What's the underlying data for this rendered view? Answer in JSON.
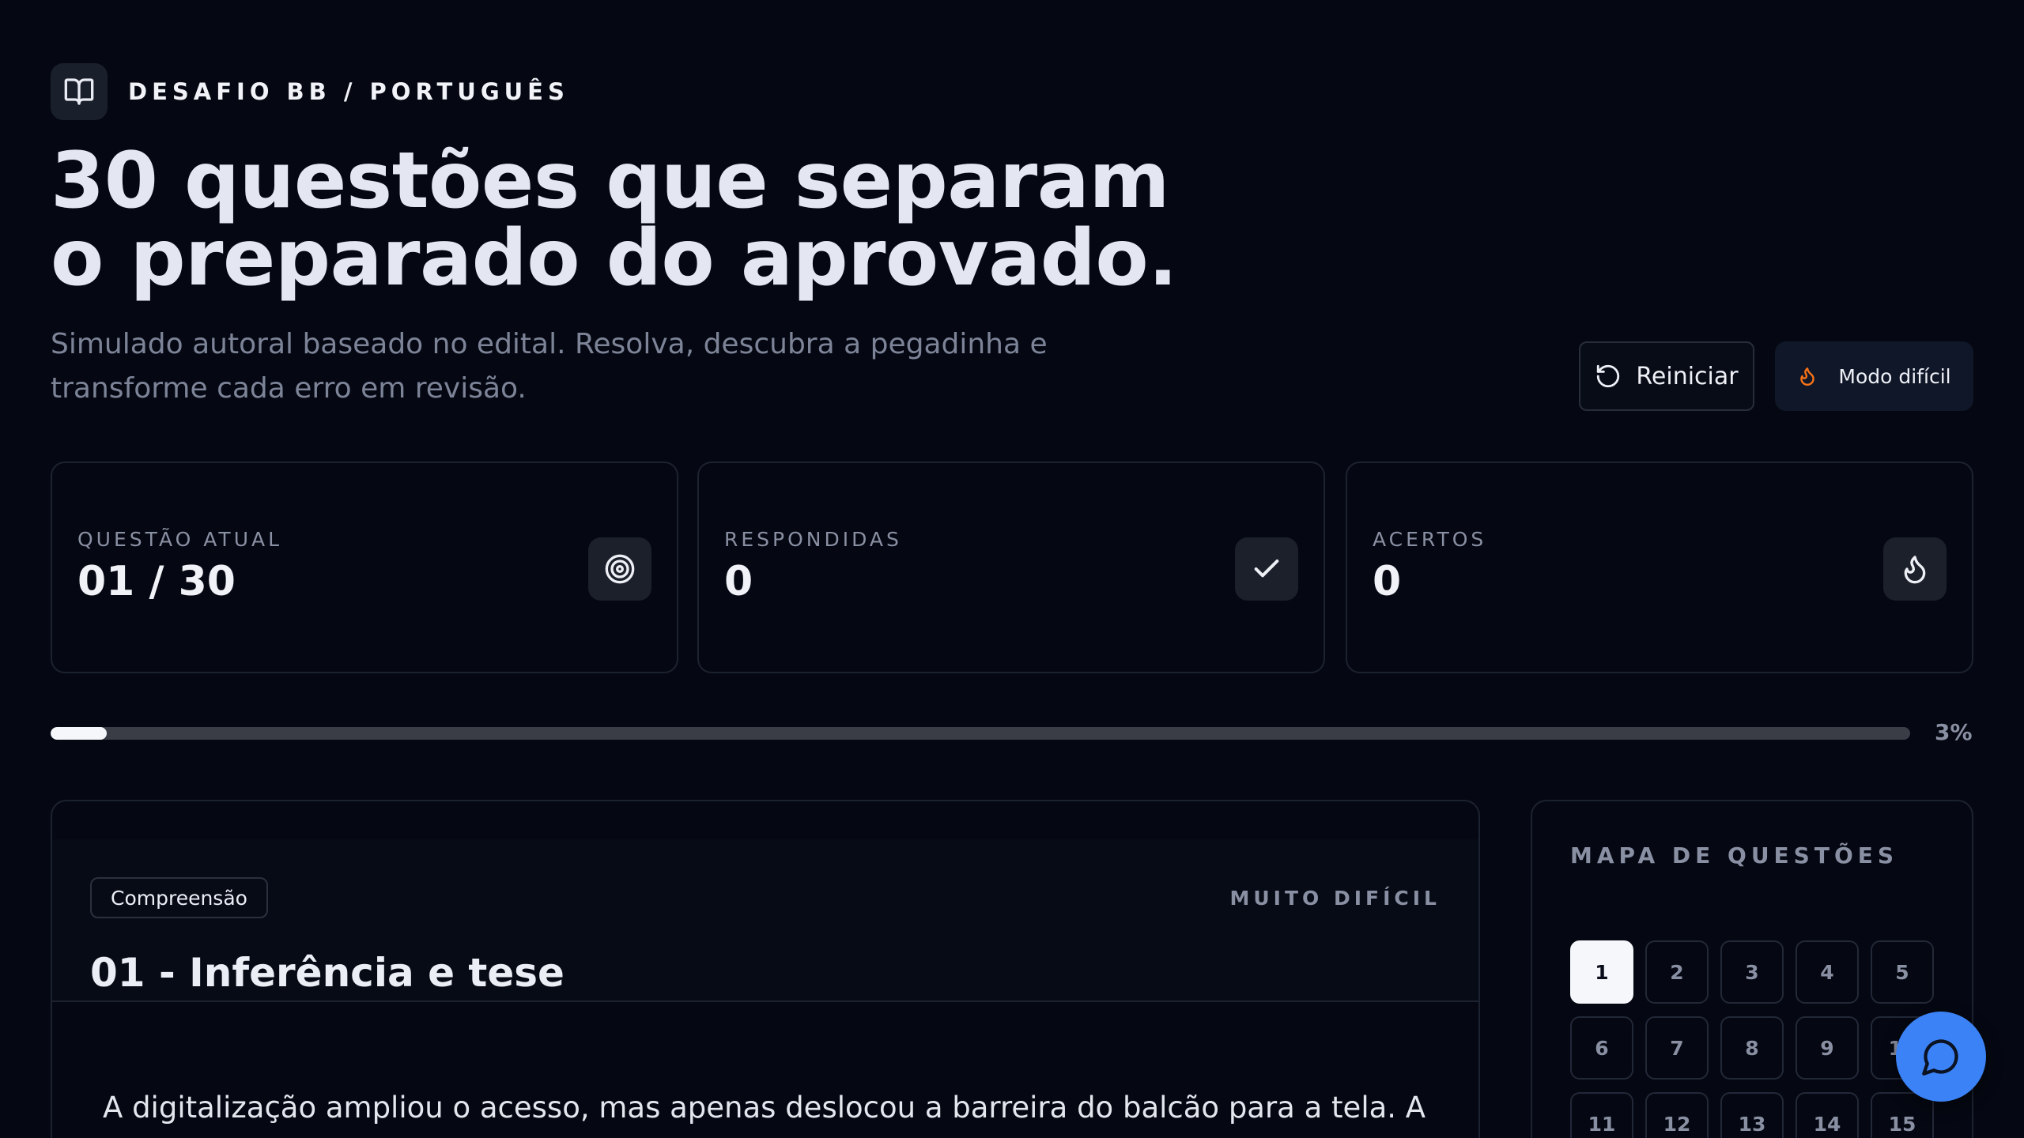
{
  "breadcrumb": {
    "text": "DESAFIO BB / PORTUGUÊS",
    "icon": "book-icon"
  },
  "hero": {
    "title_line1": "30 questões que separam",
    "title_line2": "o preparado do aprovado.",
    "subtitle_line1": "Simulado autoral baseado no edital. Resolva, descubra a pegadinha e",
    "subtitle_line2": "transforme cada erro em revisão."
  },
  "actions": {
    "restart_label": "Reiniciar",
    "restart_icon": "rotate-ccw-icon",
    "hard_mode_label": "Modo difícil",
    "hard_mode_icon": "flame-icon",
    "hard_mode_icon_color": "#f97316"
  },
  "stats": [
    {
      "label": "QUESTÃO ATUAL",
      "value": "01 / 30",
      "icon": "target-icon"
    },
    {
      "label": "RESPONDIDAS",
      "value": "0",
      "icon": "check-icon"
    },
    {
      "label": "ACERTOS",
      "value": "0",
      "icon": "flame-icon"
    }
  ],
  "progress": {
    "percent": 3,
    "label": "3%"
  },
  "question": {
    "tag": "Compreensão",
    "difficulty": "MUITO DIFÍCIL",
    "title": "01 - Inferência e tese",
    "text": "A digitalização ampliou o acesso, mas apenas deslocou a barreira do balcão para a tela. A"
  },
  "map": {
    "title": "MAPA DE QUESTÕES",
    "active": 1,
    "cells": [
      "1",
      "2",
      "3",
      "4",
      "5",
      "6",
      "7",
      "8",
      "9",
      "10",
      "11",
      "12",
      "13",
      "14",
      "15"
    ]
  },
  "chat": {
    "icon": "chat-bubble-icon",
    "color": "#3b82f6"
  }
}
